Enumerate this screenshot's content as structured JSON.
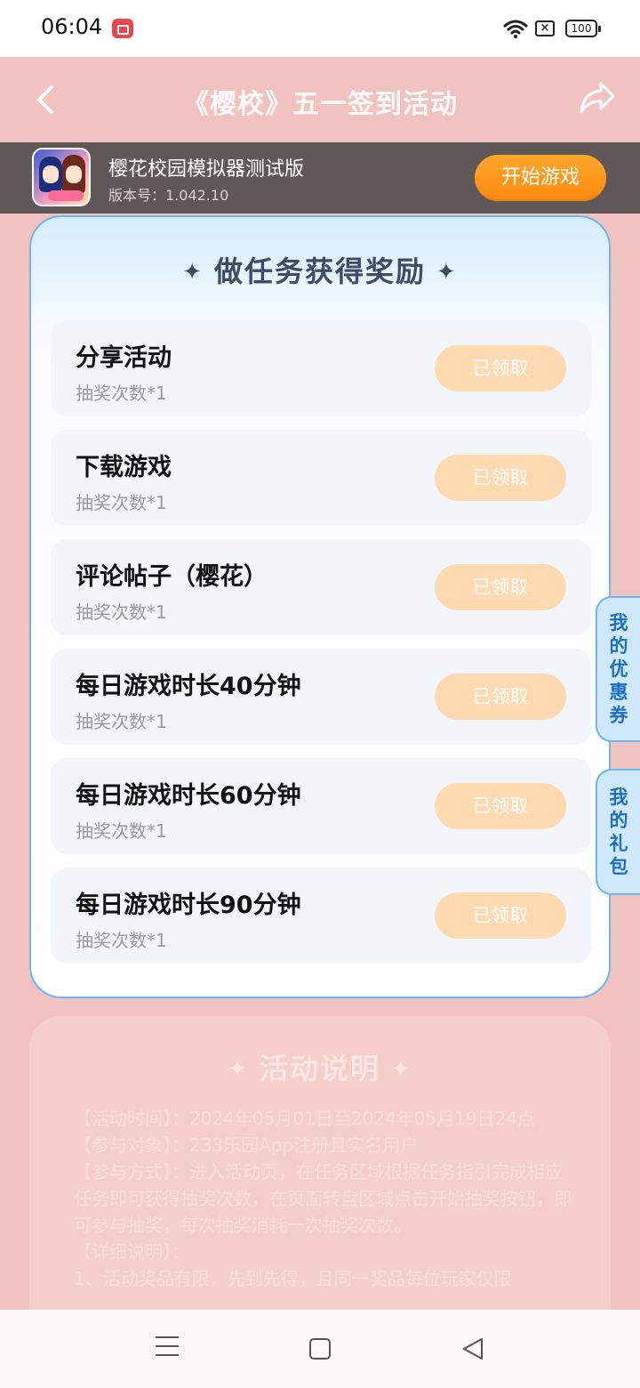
{
  "status_bar": {
    "time": "06:04",
    "battery": "100"
  },
  "header": {
    "title": "《樱校》五一签到活动"
  },
  "game": {
    "name": "樱花校园模拟器测试版",
    "version": "版本号：1.042.10",
    "start_label": "开始游戏"
  },
  "tasks_card": {
    "title": "做任务获得奖励",
    "items": [
      {
        "name": "分享活动",
        "reward": "抽奖次数*1",
        "button": "已领取"
      },
      {
        "name": "下载游戏",
        "reward": "抽奖次数*1",
        "button": "已领取"
      },
      {
        "name": "评论帖子（樱花）",
        "reward": "抽奖次数*1",
        "button": "已领取"
      },
      {
        "name": "每日游戏时长40分钟",
        "reward": "抽奖次数*1",
        "button": "已领取"
      },
      {
        "name": "每日游戏时长60分钟",
        "reward": "抽奖次数*1",
        "button": "已领取"
      },
      {
        "name": "每日游戏时长90分钟",
        "reward": "抽奖次数*1",
        "button": "已领取"
      }
    ]
  },
  "side_tabs": {
    "coupon": "我的优惠券",
    "gift": "我的礼包"
  },
  "description": {
    "title": "活动说明",
    "lines": [
      "【活动时间】：2024年05月01日至2024年05月19日24点",
      "【参与对象】：233乐园App注册且实名用户",
      "【参与方式】：进入活动页，在任务区域根据任务指引完成相应任务即可获得抽奖次数，在页面转盘区域点击开始抽奖按钮，即可参与抽奖，每次抽奖消耗一次抽奖次数。",
      "【详细说明】：",
      "1、活动奖品有限，先到先得，且同一奖品每位玩家仅限"
    ]
  },
  "colors": {
    "accent_blue": "#6fb3f3",
    "start_orange": "#ff8a0e",
    "claimed_button": "#ffd9b0",
    "page_background": "#f1c3c0"
  },
  "icons": {
    "back": "back-arrow-icon",
    "share": "share-icon",
    "record": "screen-record-icon",
    "wifi": "wifi-icon",
    "sim": "no-sim-icon",
    "battery": "battery-icon",
    "sparkle": "sparkle-icon",
    "nav_menu": "menu-icon",
    "nav_home": "home-icon",
    "nav_back": "back-triangle-icon"
  }
}
